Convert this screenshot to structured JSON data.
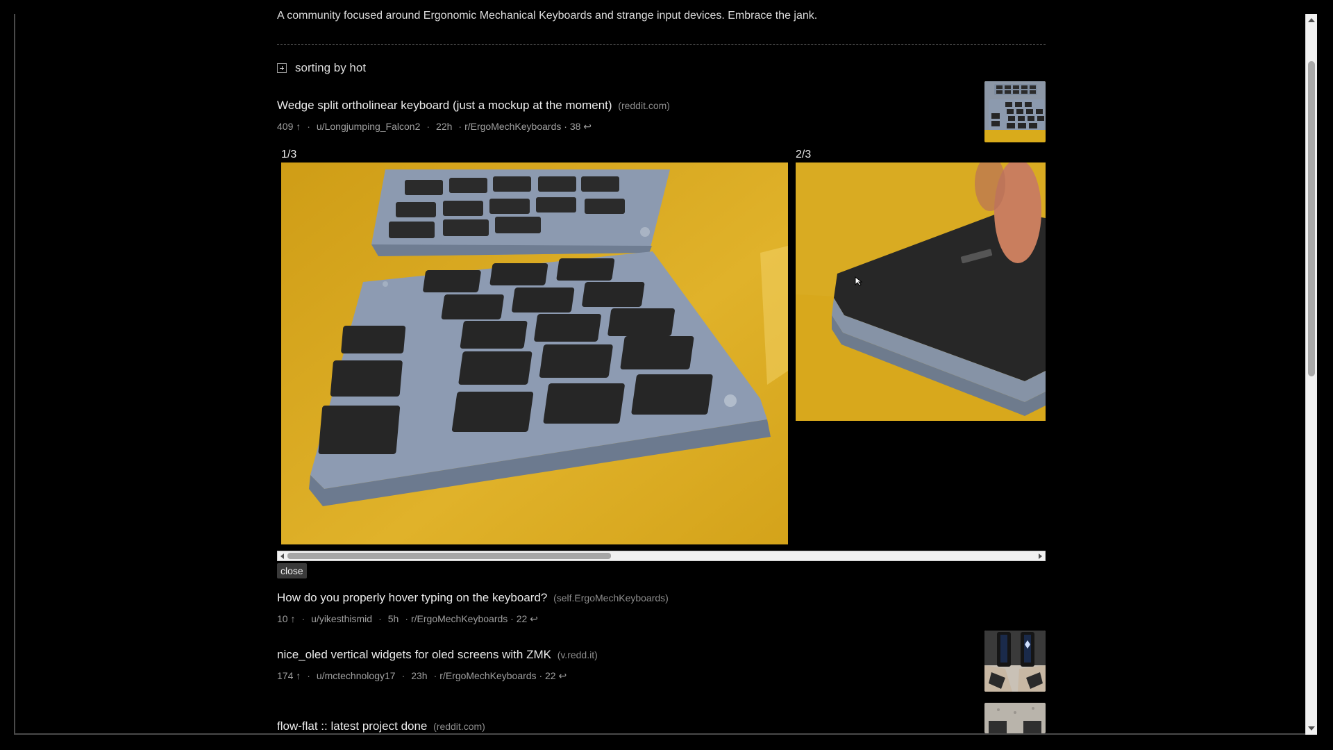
{
  "subreddit": {
    "description": "A community focused around Ergonomic Mechanical Keyboards and strange input devices. Embrace the jank."
  },
  "sorting": {
    "label": "sorting by hot"
  },
  "posts": [
    {
      "title": "Wedge split ortholinear keyboard (just a mockup at the moment)",
      "domain": "(reddit.com)",
      "score": "409 ↑",
      "author": "u/Longjumping_Falcon2",
      "age": "22h",
      "subreddit": "r/ErgoMechKeyboards",
      "comments": "· 38 ↩",
      "thumbnail": "keyboard-mockup-thumbnail"
    },
    {
      "title": "How do you properly hover typing on the keyboard?",
      "domain": "(self.ErgoMechKeyboards)",
      "score": "10 ↑",
      "author": "u/yikesthismid",
      "age": "5h",
      "subreddit": "r/ErgoMechKeyboards",
      "comments": "· 22 ↩"
    },
    {
      "title": "nice_oled vertical widgets for oled screens with ZMK",
      "domain": "(v.redd.it)",
      "score": "174 ↑",
      "author": "u/mctechnology17",
      "age": "23h",
      "subreddit": "r/ErgoMechKeyboards",
      "comments": "· 22 ↩",
      "thumbnail": "oled-keyboard-thumbnail"
    },
    {
      "title": "flow-flat :: latest project done",
      "domain": "(reddit.com)",
      "thumbnail": "flow-flat-thumbnail"
    }
  ],
  "gallery": {
    "first_count": "1/3",
    "second_count": "2/3",
    "close_label": "close"
  },
  "colors": {
    "background": "#000000",
    "desk_yellow": "#d9ab1b",
    "keyboard_case": "#8a9ab4",
    "keycap": "#2a2a2a"
  }
}
